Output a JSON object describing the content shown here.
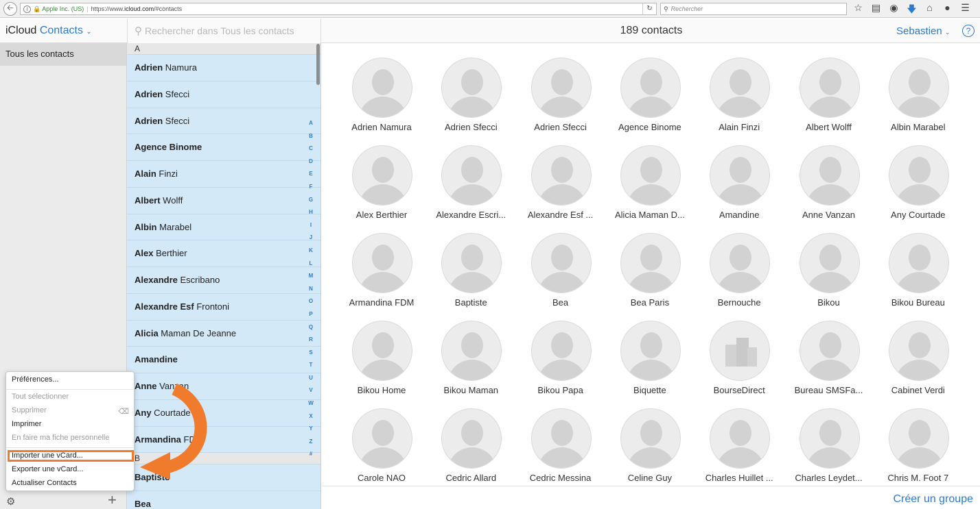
{
  "browser": {
    "org": "Apple Inc. (US)",
    "url_prefix": "https://www.",
    "url_host": "icloud.com",
    "url_path": "/#contacts",
    "search_placeholder": "Rechercher",
    "toolbar_icons": [
      "star-icon",
      "reading-list-icon",
      "pocket-icon",
      "download-icon",
      "home-icon",
      "chat-icon",
      "hamburger-menu-icon"
    ]
  },
  "header": {
    "brand": "iCloud",
    "app_name": "Contacts",
    "search_placeholder": "Rechercher dans Tous les contacts",
    "count": "189 contacts",
    "user": "Sebastien",
    "help": "?"
  },
  "sidebar": {
    "group": "Tous les contacts"
  },
  "list": {
    "section_a": "A",
    "section_b": "B",
    "rows": [
      {
        "first": "Adrien",
        "last": " Namura"
      },
      {
        "first": "Adrien",
        "last": " Sfecci"
      },
      {
        "first": "Adrien",
        "last": " Sfecci"
      },
      {
        "first": "Agence Binome",
        "last": ""
      },
      {
        "first": "Alain",
        "last": " Finzi"
      },
      {
        "first": "Albert",
        "last": " Wolff"
      },
      {
        "first": "Albin",
        "last": " Marabel"
      },
      {
        "first": "Alex",
        "last": " Berthier"
      },
      {
        "first": "Alexandre",
        "last": " Escribano"
      },
      {
        "first": "Alexandre Esf",
        "last": " Frontoni"
      },
      {
        "first": "Alicia",
        "last": " Maman De Jeanne"
      },
      {
        "first": "Amandine",
        "last": ""
      },
      {
        "first": "Anne",
        "last": " Vanzan"
      },
      {
        "first": "Any",
        "last": " Courtade"
      },
      {
        "first": "Armandina",
        "last": " FDM"
      }
    ],
    "rows_b": [
      {
        "first": "Baptiste",
        "last": ""
      },
      {
        "first": "Bea",
        "last": ""
      }
    ],
    "alphabet": [
      "A",
      "B",
      "C",
      "D",
      "E",
      "F",
      "G",
      "H",
      "I",
      "J",
      "K",
      "L",
      "M",
      "N",
      "O",
      "P",
      "Q",
      "R",
      "S",
      "T",
      "U",
      "V",
      "W",
      "X",
      "Y",
      "Z",
      "#"
    ]
  },
  "grid": {
    "contacts": [
      "Adrien Namura",
      "Adrien Sfecci",
      "Adrien Sfecci",
      "Agence Binome",
      "Alain Finzi",
      "Albert Wolff",
      "Albin Marabel",
      "Alex Berthier",
      "Alexandre Escri...",
      "Alexandre Esf ...",
      "Alicia Maman D...",
      "Amandine",
      "Anne Vanzan",
      "Any Courtade",
      "Armandina FDM",
      "Baptiste",
      "Bea",
      "Bea Paris",
      "Bernouche",
      "Bikou",
      "Bikou Bureau",
      "Bikou Home",
      "Bikou Maman",
      "Bikou Papa",
      "Biquette",
      "BourseDirect",
      "Bureau SMSFa...",
      "Cabinet Verdi",
      "Carole NAO",
      "Cedric Allard",
      "Cedric Messina",
      "Celine Guy",
      "Charles Huillet ...",
      "Charles Leydet...",
      "Chris M. Foot 7"
    ],
    "company_avatar_index": 25,
    "create_group": "Créer un groupe"
  },
  "menu": {
    "preferences": "Préférences...",
    "select_all": "Tout sélectionner",
    "delete": "Supprimer",
    "print": "Imprimer",
    "make_my_card": "En faire ma fiche personnelle",
    "import_vcard": "Importer une vCard...",
    "export_vcard": "Exporter une vCard...",
    "refresh": "Actualiser Contacts"
  },
  "colors": {
    "accent": "#2b7bd0",
    "list_background": "#d4e9f8",
    "highlight": "#f07b2c"
  }
}
